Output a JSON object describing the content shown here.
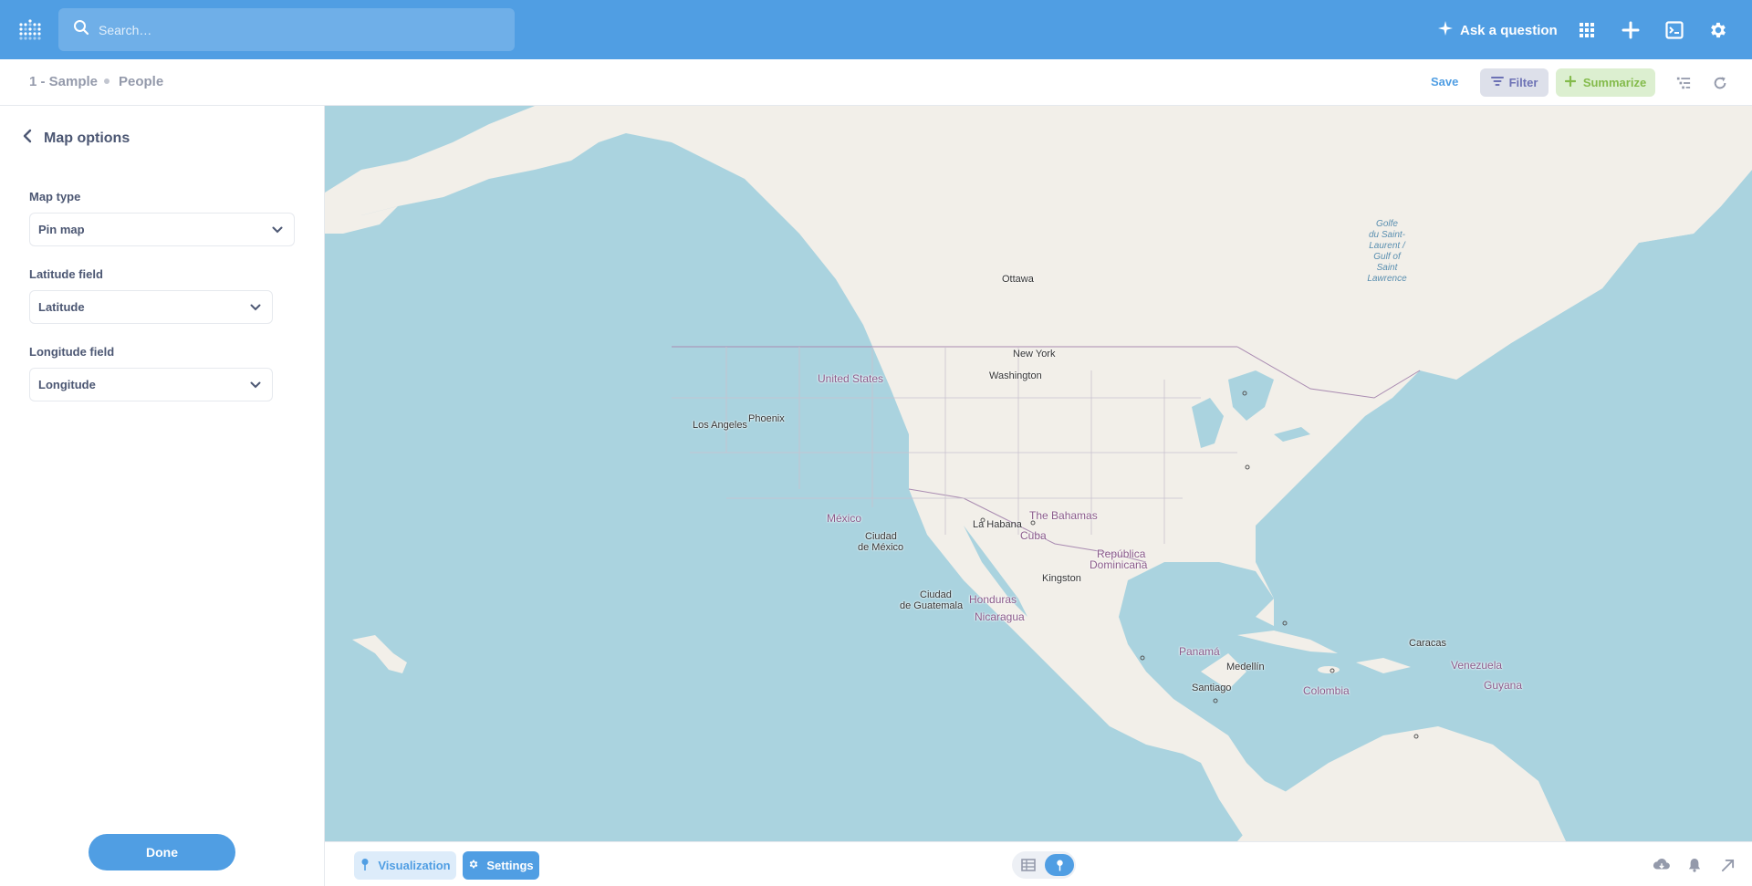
{
  "topnav": {
    "search_placeholder": "Search…",
    "ask_label": "Ask a question",
    "icons": [
      "grid-icon",
      "plus-icon",
      "sql-editor-icon",
      "gear-icon"
    ]
  },
  "breadcrumb": {
    "database": "1 - Sample",
    "table": "People"
  },
  "question_bar": {
    "save_label": "Save",
    "filter_label": "Filter",
    "summarize_label": "Summarize"
  },
  "sidebar": {
    "title": "Map options",
    "map_type_label": "Map type",
    "map_type_value": "Pin map",
    "latitude_label": "Latitude field",
    "latitude_value": "Latitude",
    "longitude_label": "Longitude field",
    "longitude_value": "Longitude",
    "done_label": "Done"
  },
  "map": {
    "labels": {
      "ottawa": "Ottawa",
      "new_york": "New York",
      "washington": "Washington",
      "united_states": "United States",
      "los_angeles": "Los Angeles",
      "phoenix": "Phoenix",
      "mexico": "México",
      "ciudad_mexico_1": "Ciudad",
      "ciudad_mexico_2": "de México",
      "la_habana": "La Habana",
      "the_bahamas": "The Bahamas",
      "cuba": "Cuba",
      "republica_1": "República",
      "republica_2": "Dominicana",
      "kingston": "Kingston",
      "guatemala_1": "Ciudad",
      "guatemala_2": "de Guatemala",
      "honduras": "Honduras",
      "nicaragua": "Nicaragua",
      "panama": "Panamá",
      "medellin": "Medellín",
      "caracas": "Caracas",
      "venezuela": "Venezuela",
      "guyana": "Guyana",
      "santiago": "Santiago",
      "colombia": "Colombia",
      "golfe": "Golfe du Saint-Laurent / Gulf of Saint Lawrence"
    },
    "golfe_lines": [
      "Golfe",
      "du Saint-",
      "Laurent /",
      "Gulf of",
      "Saint",
      "Lawrence"
    ]
  },
  "footer": {
    "visualization_label": "Visualization",
    "settings_label": "Settings"
  },
  "colors": {
    "brand": "#509ee3",
    "summarize": "#84bb4c",
    "filter": "#7172ad",
    "water": "#aad3df",
    "land": "#f2efe9"
  }
}
